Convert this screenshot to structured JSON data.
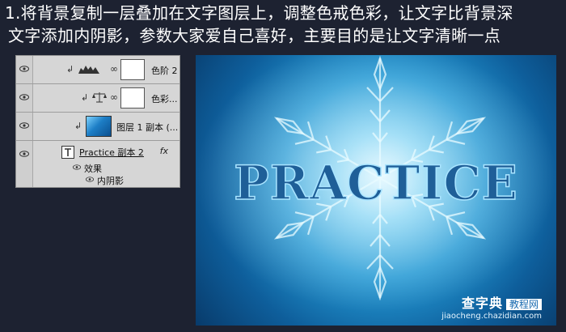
{
  "instructions": {
    "line1": "1.将背景复制一层叠加在文字图层上，调整色戒色彩，让文字比背景深",
    "line2": "文字添加内阴影，参数大家爱自己喜好，主要目的是让文字清晰一点"
  },
  "layers_panel": {
    "layers": [
      {
        "name": "色阶 2",
        "type": "levels-adjustment"
      },
      {
        "name": "色彩...",
        "type": "color-balance-adjustment"
      },
      {
        "name": "图层 1 副本 (...",
        "type": "pixel-layer"
      },
      {
        "name": "Practice 副本 2",
        "type": "text-layer",
        "fx": "fx"
      }
    ],
    "effects_label": "效果",
    "inner_shadow_label": "内阴影"
  },
  "canvas": {
    "text": "PRACTICE",
    "watermark": {
      "brand": "查字典",
      "sub": "教程网",
      "url": "jiaocheng.chazidian.com"
    }
  },
  "colors": {
    "background": "#1d2231",
    "ice_light": "#c9f1ff",
    "ice_dark": "#083b6b",
    "text_fill": "#1f5f98"
  }
}
